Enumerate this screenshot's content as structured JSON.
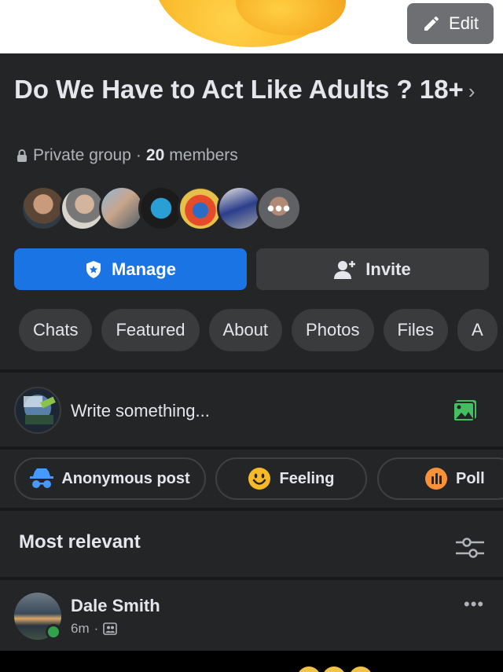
{
  "cover": {
    "edit_label": "Edit"
  },
  "group": {
    "name": "Do We Have to Act Like Adults ? 18+",
    "chevron": "›",
    "privacy": "Private group",
    "separator": "·",
    "member_count": "20",
    "members_label": "members",
    "more_members": "•••"
  },
  "actions": {
    "manage_label": "Manage",
    "invite_label": "Invite"
  },
  "tabs": [
    "Chats",
    "Featured",
    "About",
    "Photos",
    "Files",
    "A"
  ],
  "composer": {
    "placeholder": "Write something..."
  },
  "quick_actions": {
    "anonymous": "Anonymous post",
    "feeling": "Feeling",
    "poll": "Poll"
  },
  "feed": {
    "sort_label": "Most relevant"
  },
  "post": {
    "author": "Dale Smith",
    "time": "6m",
    "separator": "·",
    "more": "•••"
  },
  "colors": {
    "accent": "#1b74e4",
    "background": "#242526",
    "online": "#31a24c",
    "photo_icon": "#45bd62",
    "poll_icon": "#f7923b",
    "feeling_icon": "#f7b928"
  }
}
